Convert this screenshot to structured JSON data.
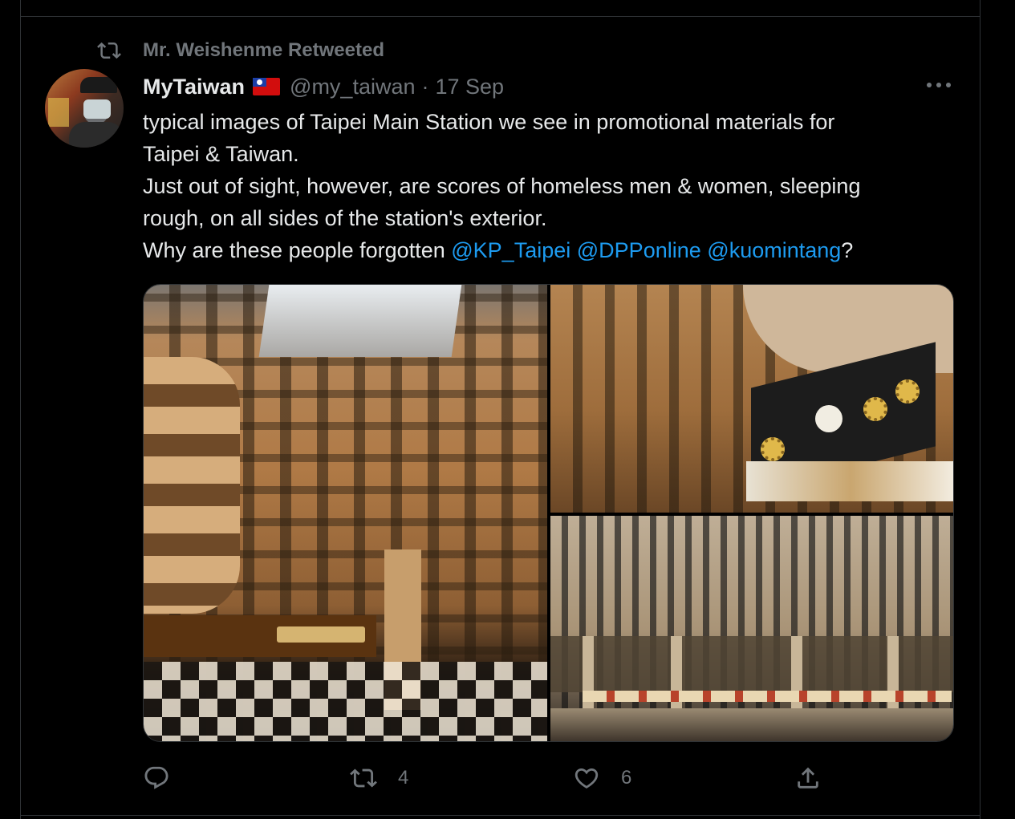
{
  "retweet_banner": {
    "icon": "retweet-icon",
    "text": "Mr. Weishenme Retweeted"
  },
  "author": {
    "display_name": "MyTaiwan",
    "flag_icon": "taiwan-flag-icon",
    "handle": "@my_taiwan",
    "separator": "·",
    "date": "17 Sep"
  },
  "tweet": {
    "lines": [
      "typical images of Taipei Main Station we see in promotional materials for",
      "Taipei & Taiwan.",
      "Just out of sight, however, are scores of homeless men & women, sleeping",
      "rough, on all  sides of the station's exterior."
    ],
    "last_line_prefix": "Why are these people forgotten ",
    "mentions": [
      "@KP_Taipei",
      "@DPPonline",
      "@kuomintang"
    ],
    "last_line_suffix": "?"
  },
  "media": {
    "photo_count": 3
  },
  "actions": {
    "reply_count": "",
    "retweet_count": "4",
    "like_count": "6",
    "share_count": ""
  },
  "colors": {
    "background": "#000000",
    "text": "#e7e9ea",
    "muted": "#71767b",
    "link": "#1d9bf0",
    "border": "#2f3336"
  }
}
